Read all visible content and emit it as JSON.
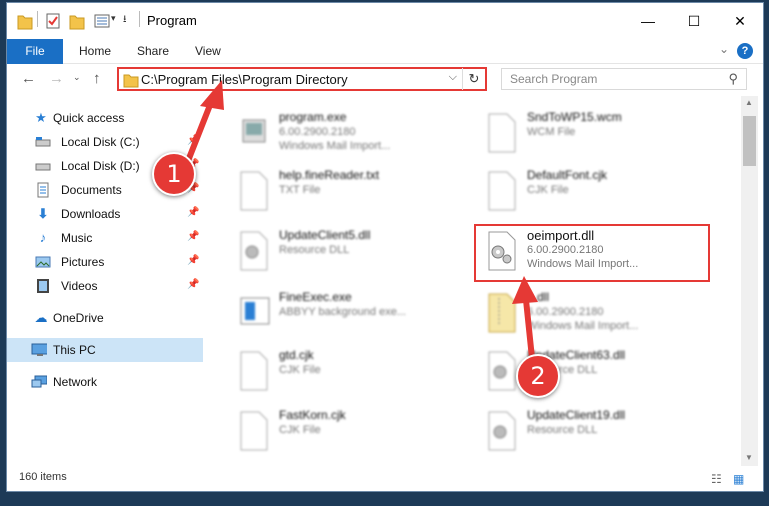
{
  "window": {
    "title": "Program",
    "controls": {
      "minimize": "—",
      "maximize": "☐",
      "close": "✕"
    }
  },
  "ribbon": {
    "tabs": [
      "File",
      "Home",
      "Share",
      "View"
    ],
    "help": "?"
  },
  "navbar": {
    "address": "C:\\Program Files\\Program Directory",
    "search_placeholder": "Search Program"
  },
  "sidebar": {
    "items": [
      {
        "label": "Quick access",
        "icon": "star-icon",
        "pinned": false
      },
      {
        "label": "Local Disk (C:)",
        "icon": "drive-icon",
        "pinned": true
      },
      {
        "label": "Local Disk (D:)",
        "icon": "drive-icon",
        "pinned": true
      },
      {
        "label": "Documents",
        "icon": "document-icon",
        "pinned": true
      },
      {
        "label": "Downloads",
        "icon": "download-icon",
        "pinned": true
      },
      {
        "label": "Music",
        "icon": "music-icon",
        "pinned": true
      },
      {
        "label": "Pictures",
        "icon": "picture-icon",
        "pinned": true
      },
      {
        "label": "Videos",
        "icon": "video-icon",
        "pinned": true
      },
      {
        "label": "OneDrive",
        "icon": "cloud-icon",
        "pinned": false
      },
      {
        "label": "This PC",
        "icon": "pc-icon",
        "pinned": false,
        "selected": true
      },
      {
        "label": "Network",
        "icon": "network-icon",
        "pinned": false
      }
    ]
  },
  "files": [
    {
      "name": "program.exe",
      "line1": "6.00.2900.2180",
      "line2": "Windows Mail Import...",
      "type": "exe"
    },
    {
      "name": "SndToWP15.wcm",
      "line1": "WCM File",
      "line2": "",
      "type": "doc"
    },
    {
      "name": "help.fineReader.txt",
      "line1": "TXT File",
      "line2": "",
      "type": "doc"
    },
    {
      "name": "DefaultFont.cjk",
      "line1": "CJK File",
      "line2": "",
      "type": "doc"
    },
    {
      "name": "UpdateClient5.dll",
      "line1": "Resource DLL",
      "line2": "",
      "type": "dll"
    },
    {
      "name": "oeimport.dll",
      "line1": "6.00.2900.2180",
      "line2": "Windows Mail Import...",
      "type": "dll",
      "highlighted": true
    },
    {
      "name": "FineExec.exe",
      "line1": "ABBYY background exe...",
      "line2": "",
      "type": "exe2"
    },
    {
      "name": "...dll",
      "line1": "6.00.2900.2180",
      "line2": "Windows Mail Import...",
      "type": "zip"
    },
    {
      "name": "gtd.cjk",
      "line1": "CJK File",
      "line2": "",
      "type": "doc"
    },
    {
      "name": "UpdateClient63.dll",
      "line1": "Resource DLL",
      "line2": "",
      "type": "dll"
    },
    {
      "name": "FastKorn.cjk",
      "line1": "CJK File",
      "line2": "",
      "type": "doc"
    },
    {
      "name": "UpdateClient19.dll",
      "line1": "Resource DLL",
      "line2": "",
      "type": "dll"
    }
  ],
  "status": {
    "items_count": "160 items"
  },
  "annotations": {
    "step1": "1",
    "step2": "2",
    "color": "#e53935"
  }
}
